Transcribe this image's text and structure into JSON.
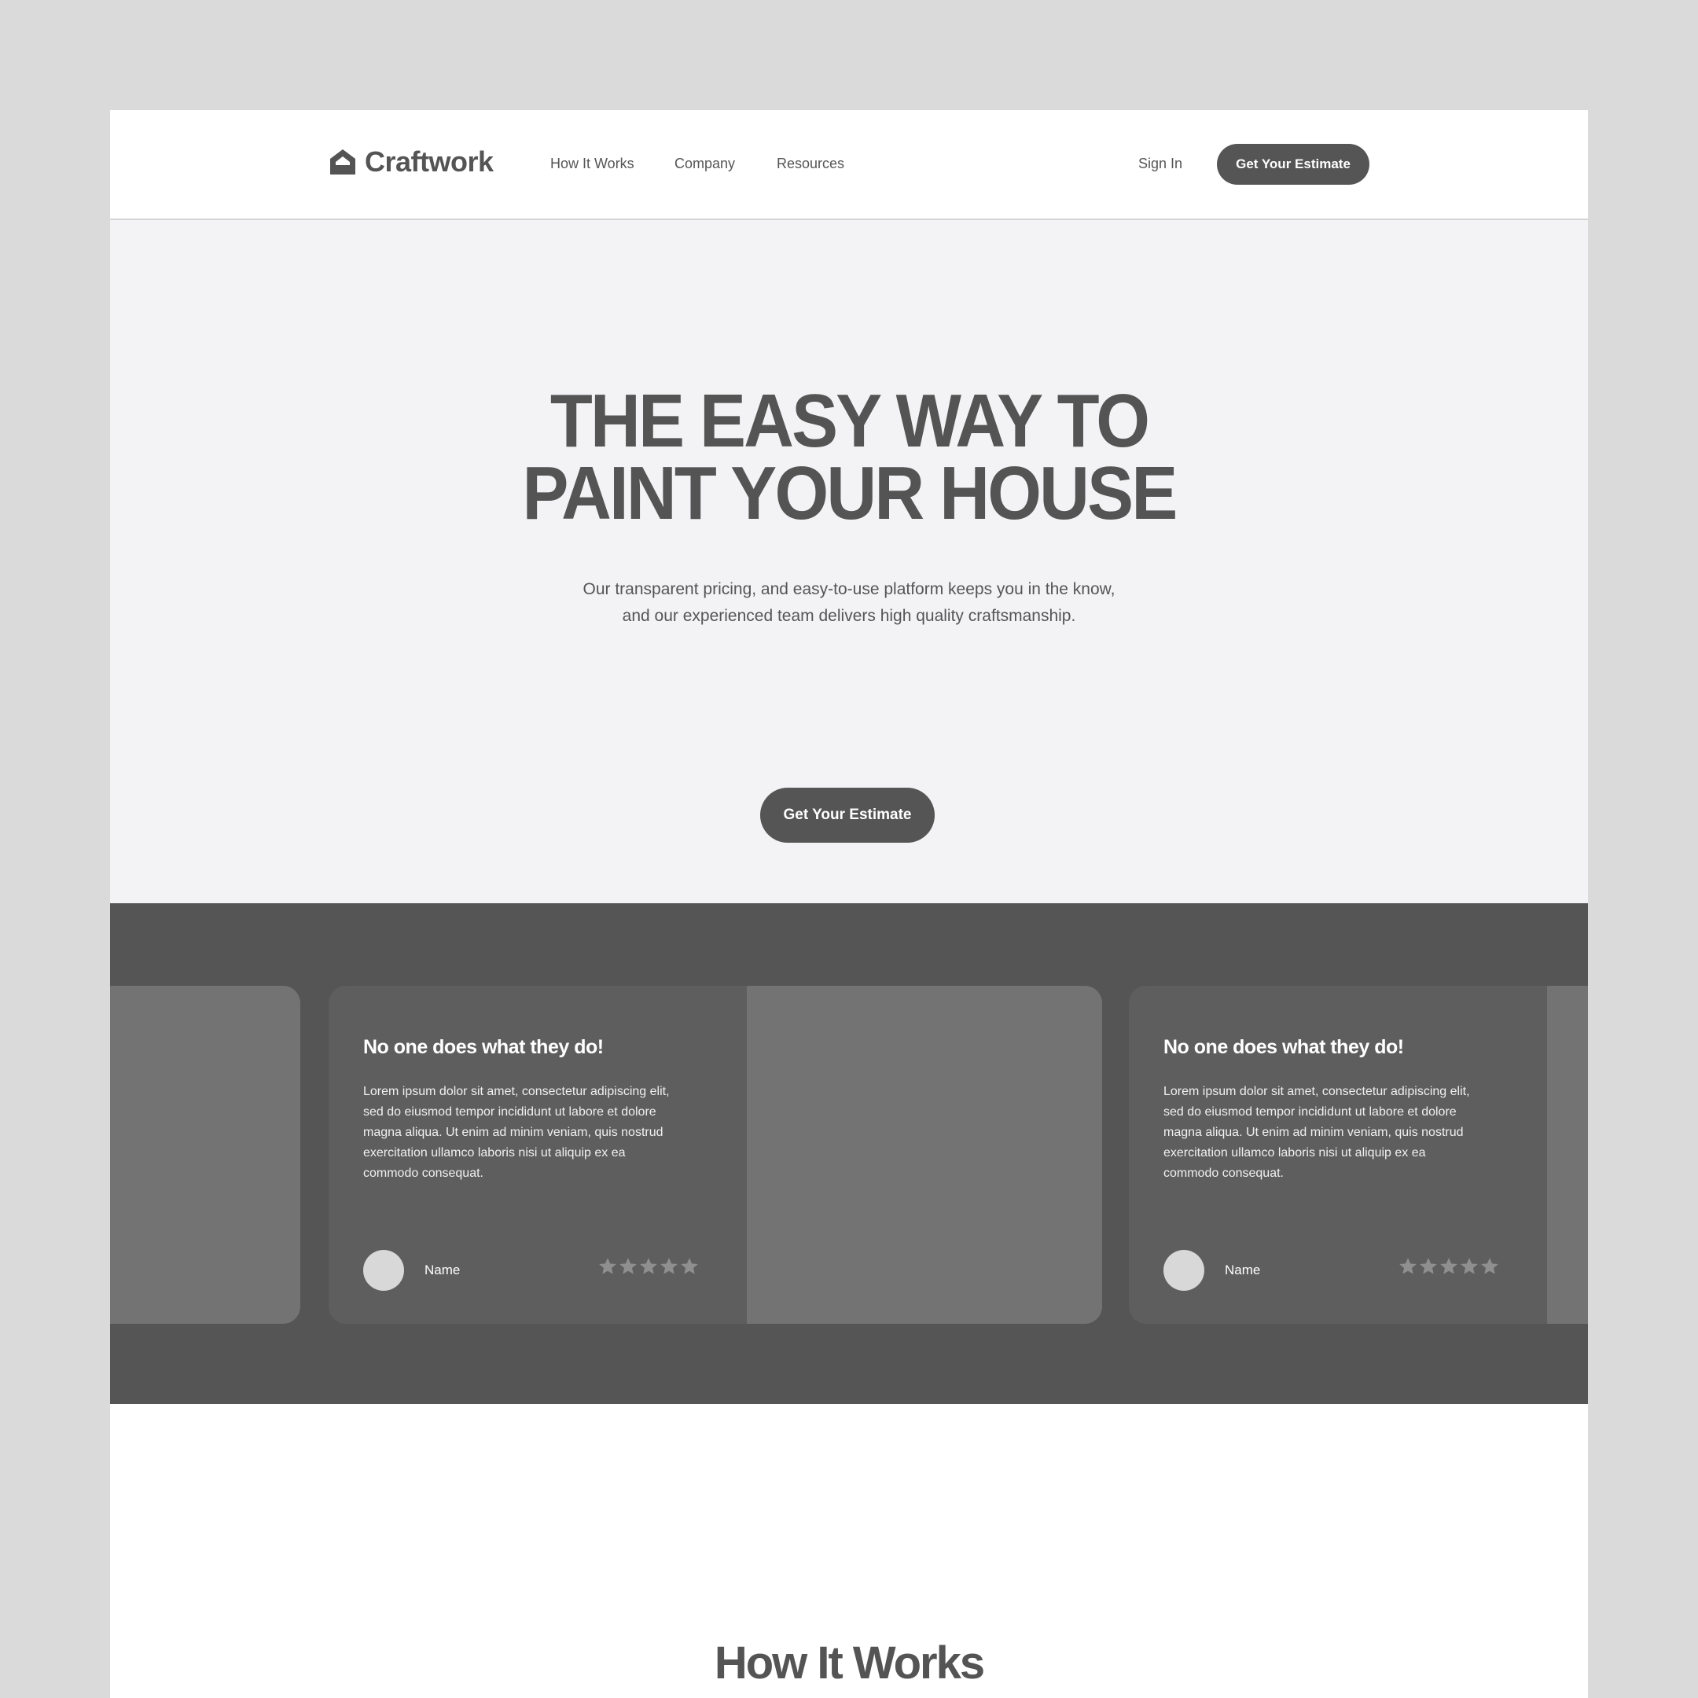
{
  "brand": {
    "name": "Craftwork"
  },
  "nav": {
    "links": [
      "How It Works",
      "Company",
      "Resources"
    ],
    "sign_in": "Sign In",
    "cta": "Get Your Estimate"
  },
  "hero": {
    "title_lines": [
      "THE EASY WAY TO",
      "PAINT YOUR HOUSE"
    ],
    "subtitle_lines": [
      "Our transparent pricing, and easy-to-use platform keeps you in the know,",
      "and our experienced team delivers high quality craftsmanship."
    ],
    "cta": "Get Your Estimate"
  },
  "testimonials": [
    {
      "title": "No one does what they do!",
      "body": "Lorem ipsum dolor sit amet, consectetur adipiscing elit, sed do eiusmod tempor incididunt ut labore et dolore magna aliqua. Ut enim ad minim veniam, quis nostrud exercitation ullamco laboris nisi ut aliquip ex ea commodo consequat.",
      "name": "Name",
      "rating": 5
    },
    {
      "title": "No one does what they do!",
      "body": "Lorem ipsum dolor sit amet, consectetur adipiscing elit, sed do eiusmod tempor incididunt ut labore et dolore magna aliqua. Ut enim ad minim veniam, quis nostrud exercitation ullamco laboris nisi ut aliquip ex ea commodo consequat.",
      "name": "Name",
      "rating": 5
    }
  ],
  "how_it_works": {
    "title": "How It Works"
  },
  "colors": {
    "background": "#dadada",
    "hero_bg": "#f3f2f4",
    "dark": "#555555",
    "card": "#5e5e5e",
    "placeholder": "#737373",
    "star": "#8f8f8f"
  }
}
